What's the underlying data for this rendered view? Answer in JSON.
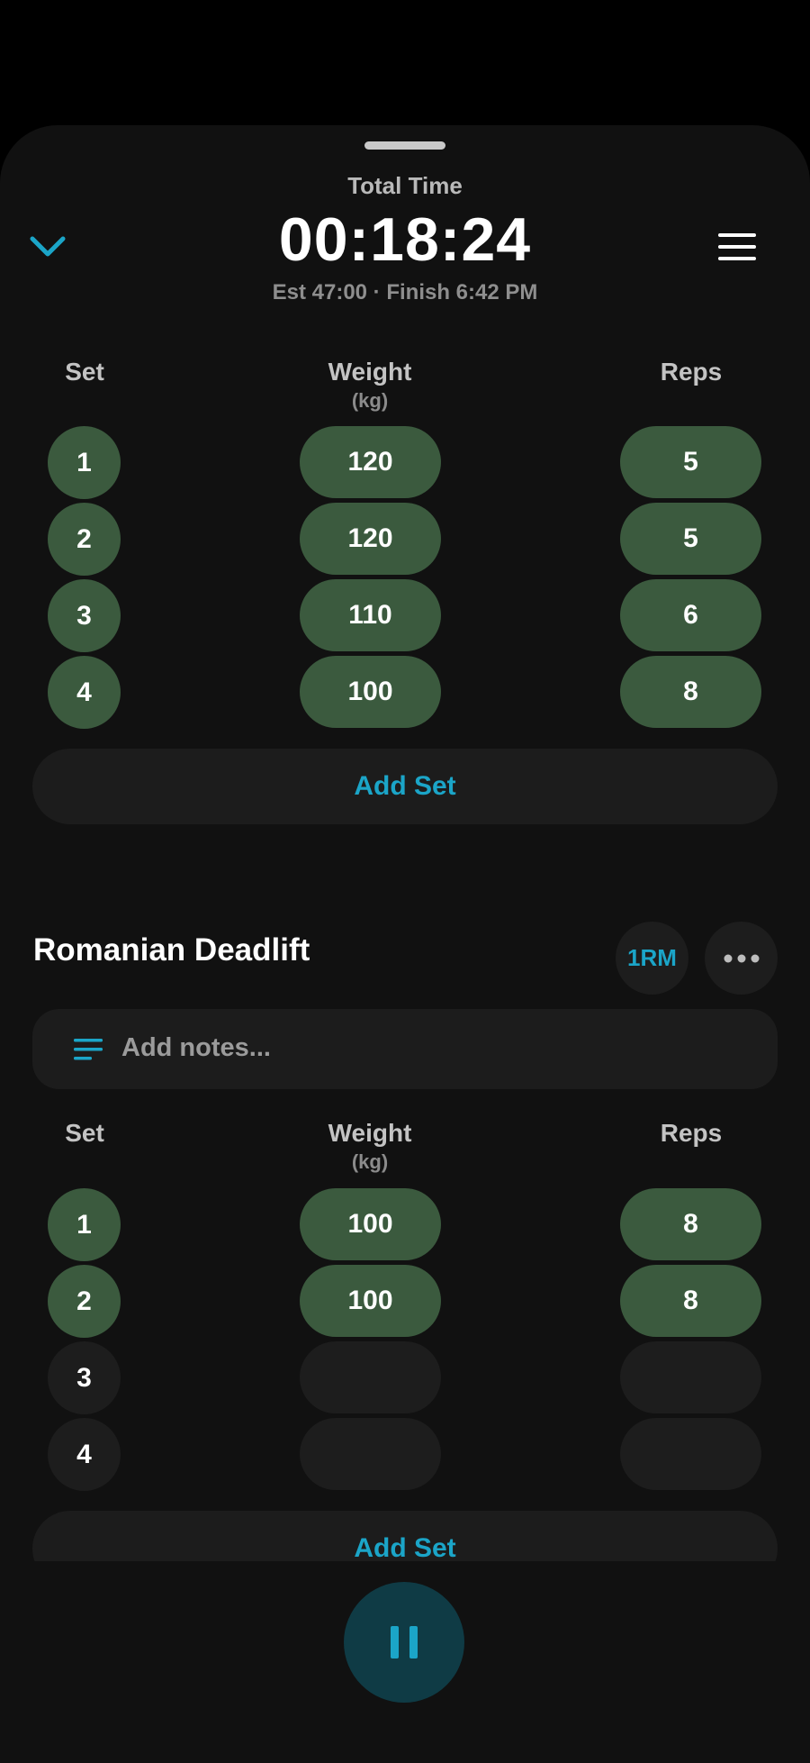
{
  "header": {
    "total_label": "Total Time",
    "timer": "00:18:24",
    "estimate": "Est 47:00 · Finish 6:42 PM"
  },
  "columns": {
    "set": "Set",
    "weight": "Weight",
    "weight_unit": "(kg)",
    "reps": "Reps"
  },
  "exercise1": {
    "sets": [
      {
        "num": "1",
        "weight": "120",
        "reps": "5"
      },
      {
        "num": "2",
        "weight": "120",
        "reps": "5"
      },
      {
        "num": "3",
        "weight": "110",
        "reps": "6"
      },
      {
        "num": "4",
        "weight": "100",
        "reps": "8"
      }
    ],
    "add_set": "Add Set"
  },
  "exercise2": {
    "title": "Romanian Deadlift",
    "one_rm": "1RM",
    "notes_placeholder": "Add notes...",
    "sets": [
      {
        "num": "1",
        "weight": "100",
        "reps": "8"
      },
      {
        "num": "2",
        "weight": "100",
        "reps": "8"
      },
      {
        "num": "3",
        "weight": "",
        "reps": ""
      },
      {
        "num": "4",
        "weight": "",
        "reps": ""
      }
    ],
    "add_set": "Add Set"
  },
  "icons": {
    "collapse": "chevron-down-icon",
    "menu": "hamburger-menu-icon",
    "more": "more-horizontal-icon",
    "notes": "notes-lines-icon",
    "pause": "pause-icon"
  },
  "colors": {
    "accent": "#1ba5c8",
    "completed_set": "#3b5a3e",
    "empty_set": "#1d1d1d",
    "sheet_bg": "#111111"
  }
}
